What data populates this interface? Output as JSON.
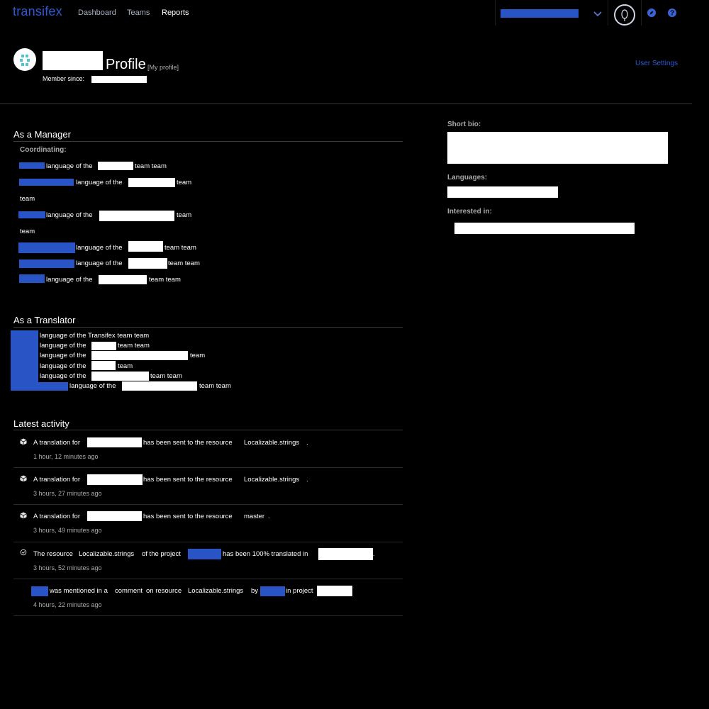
{
  "nav": {
    "logo": "transifex",
    "links": [
      "Dashboard",
      "Teams",
      "Reports"
    ]
  },
  "profile": {
    "title": "Profile",
    "my_profile": "[My profile]",
    "member_since_label": "Member since:",
    "user_settings": "User Settings"
  },
  "manager": {
    "title": "As a Manager",
    "coordinating_label": "Coordinating:",
    "lang_phrase": "language of the",
    "team": "team",
    "team_team": "team team"
  },
  "translator": {
    "title": "As a Translator",
    "first_line": "language of the Transifex team team",
    "lang_phrase": "language of the",
    "team": "team",
    "team_team": "team team"
  },
  "sidebar": {
    "short_bio": "Short bio:",
    "languages": "Languages:",
    "interested_in": "Interested in:"
  },
  "activity": {
    "title": "Latest activity",
    "items": [
      {
        "prefix": "A translation for",
        "middle": "has been sent to the resource",
        "link": "Localizable.strings",
        "suffix": ".",
        "time": "1 hour, 12 minutes ago"
      },
      {
        "prefix": "A translation for",
        "middle": "has been sent to the resource",
        "link": "Localizable.strings",
        "suffix": ".",
        "time": "3 hours, 27 minutes ago"
      },
      {
        "prefix": "A translation for",
        "middle": "has been sent to the resource",
        "link": "master",
        "suffix": ".",
        "time": "3 hours, 49 minutes ago"
      },
      {
        "prefix": "The resource",
        "link": "Localizable.strings",
        "middle": "of the project",
        "middle2": "has been 100% translated in",
        "suffix": ".",
        "time": "3 hours, 52 minutes ago"
      },
      {
        "middle": "was mentioned in a",
        "link": "comment",
        "middle2": "on resource",
        "link2": "Localizable.strings",
        "by": "by",
        "in_project": "in project",
        "time": "4 hours, 22 minutes ago"
      }
    ]
  },
  "colors": {
    "accent": "#2f5bd2",
    "redaction_blue": "#2854c5",
    "background": "#000000"
  },
  "icons": [
    "chevron-down-icon",
    "user-avatar-icon",
    "compass-icon",
    "help-icon",
    "cube-icon",
    "check-circle-icon"
  ]
}
